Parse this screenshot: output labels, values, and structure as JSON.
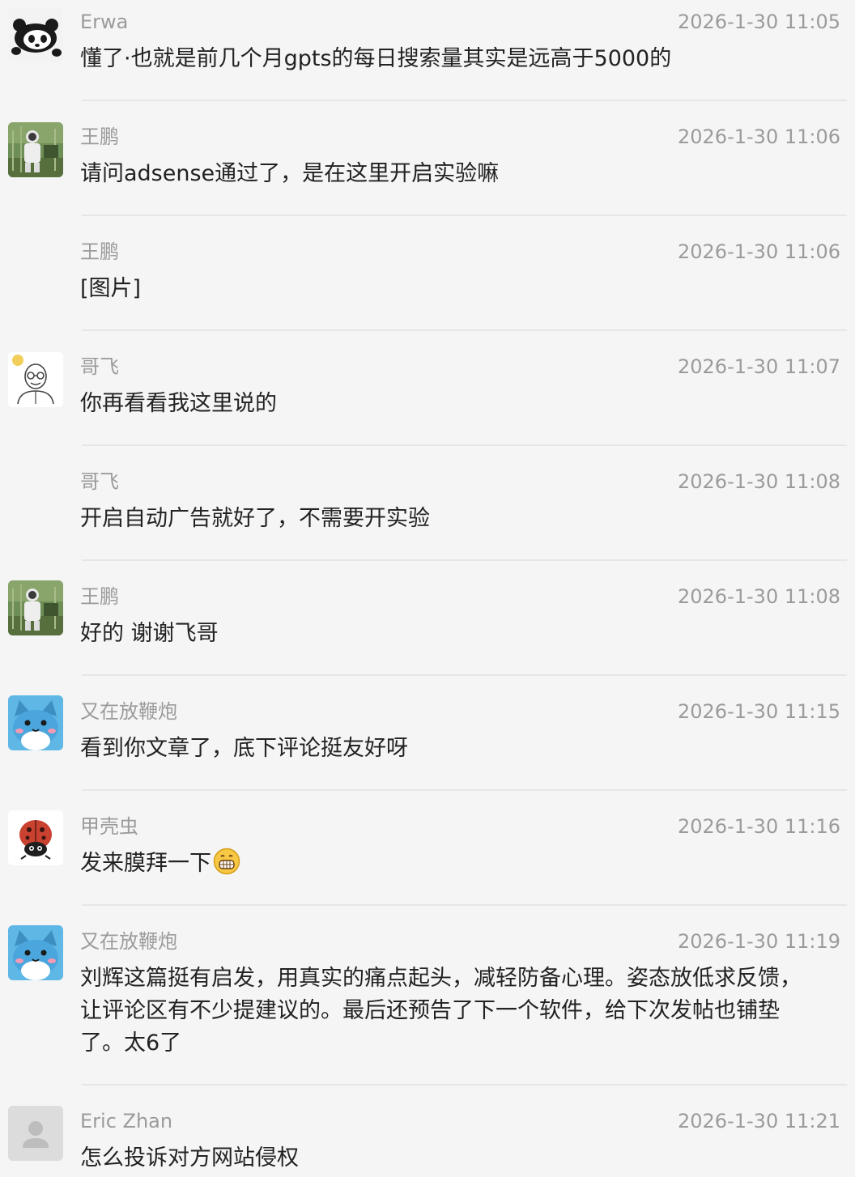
{
  "messages": [
    {
      "sender": "Erwa",
      "time": "2026-1-30 11:05",
      "text": "懂了·也就是前几个月gpts的每日搜索量其实是远高于5000的",
      "avatar_icon": "panda-avatar-icon"
    },
    {
      "sender": "王鹏",
      "time": "2026-1-30 11:06",
      "text": "请问adsense通过了，是在这里开启实验嘛",
      "avatar_icon": "astronaut-photo-avatar"
    },
    {
      "sender": "王鹏",
      "time": "2026-1-30 11:06",
      "text": "[图片]"
    },
    {
      "sender": "哥飞",
      "time": "2026-1-30 11:07",
      "text": "你再看看我这里说的",
      "avatar_icon": "glasses-man-sketch-avatar"
    },
    {
      "sender": "哥飞",
      "time": "2026-1-30 11:08",
      "text": "开启自动广告就好了，不需要开实验"
    },
    {
      "sender": "王鹏",
      "time": "2026-1-30 11:08",
      "text": "好的 谢谢飞哥",
      "avatar_icon": "astronaut-photo-avatar"
    },
    {
      "sender": "又在放鞭炮",
      "time": "2026-1-30 11:15",
      "text": "看到你文章了，底下评论挺友好呀",
      "avatar_icon": "blue-cat-avatar"
    },
    {
      "sender": "甲壳虫",
      "time": "2026-1-30 11:16",
      "text": "发来膜拜一下",
      "avatar_icon": "ladybug-avatar",
      "emoji": "grinning-face-emoji"
    },
    {
      "sender": "又在放鞭炮",
      "time": "2026-1-30 11:19",
      "text": "刘辉这篇挺有启发，用真实的痛点起头，减轻防备心理。姿态放低求反馈，让评论区有不少提建议的。最后还预告了下一个软件，给下次发帖也铺垫了。太6了",
      "avatar_icon": "blue-cat-avatar"
    },
    {
      "sender": "Eric Zhan",
      "time": "2026-1-30 11:21",
      "text": "怎么投诉对方网站侵权",
      "avatar_icon": "default-user-avatar"
    }
  ]
}
